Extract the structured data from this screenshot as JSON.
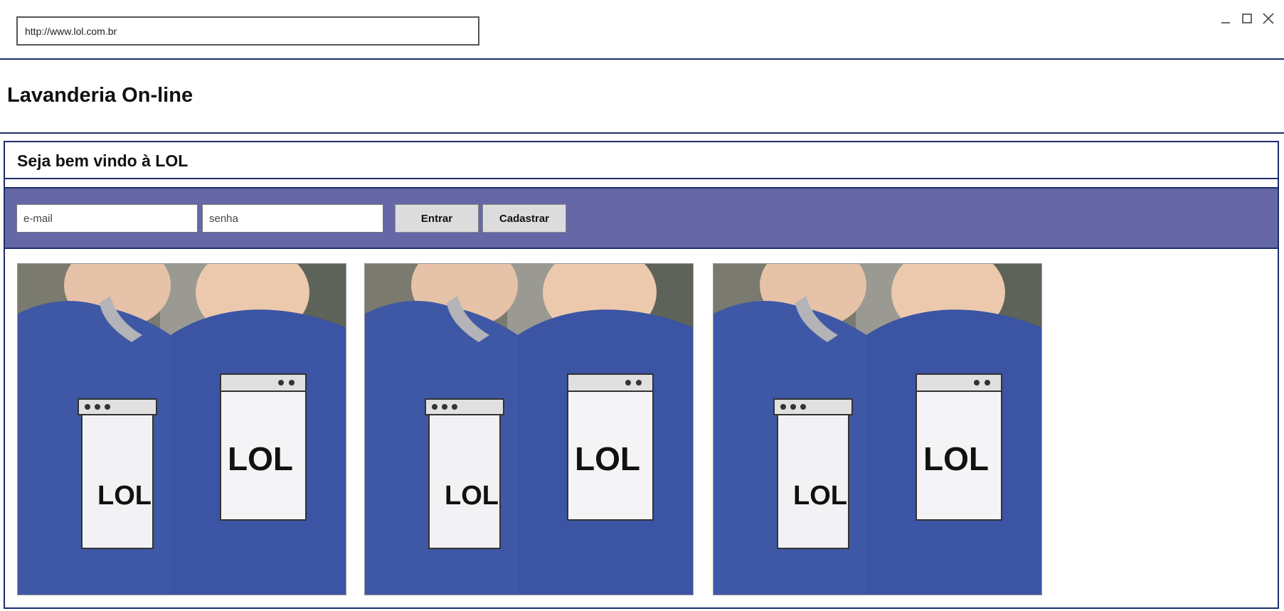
{
  "browser": {
    "url": "http://www.lol.com.br",
    "controls": {
      "minimize_icon": "minimize-icon",
      "maximize_icon": "maximize-icon",
      "close_icon": "close-icon"
    }
  },
  "header": {
    "title": "Lavanderia On-line"
  },
  "main": {
    "welcome": "Seja bem vindo à LOL",
    "login": {
      "email_placeholder": "e-mail",
      "password_placeholder": "senha",
      "login_button": "Entrar",
      "register_button": "Cadastrar"
    },
    "photos": [
      {
        "shirt_text_left": "LOL",
        "shirt_text_right": "LOL"
      },
      {
        "shirt_text_left": "LOL",
        "shirt_text_right": "LOL"
      },
      {
        "shirt_text_left": "LOL",
        "shirt_text_right": "LOL"
      }
    ]
  },
  "colors": {
    "border": "#1c2d6b",
    "login_bar": "#6667a6",
    "shirt": "#3c56a6",
    "button": "#dcdcdc"
  }
}
